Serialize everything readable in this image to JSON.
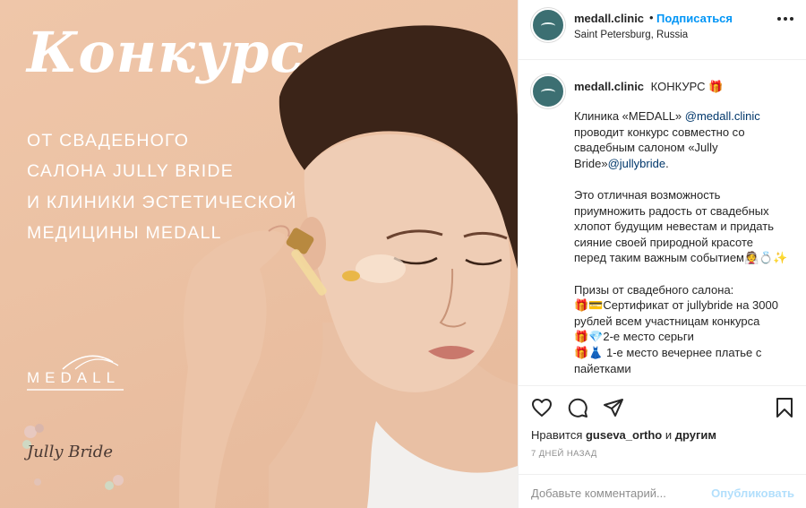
{
  "image": {
    "title": "Конкурс",
    "lines": [
      "ОТ СВАДЕБНОГО",
      "САЛОНА JULLY BRIDE",
      "И КЛИНИКИ ЭСТЕТИЧЕСКОЙ",
      "МЕДИЦИНЫ MEDALL"
    ],
    "logo_medall": "MEDALL",
    "logo_jully": "Jully Bride",
    "colors": {
      "background": "#ecc2a4",
      "text": "#ffffff"
    }
  },
  "header": {
    "username": "medall.clinic",
    "separator": "•",
    "follow_label": "Подписаться",
    "location": "Saint Petersburg, Russia",
    "more_icon": "more-horizontal-icon"
  },
  "caption": {
    "username": "medall.clinic",
    "headline": "КОНКУРС 🎁",
    "p1": {
      "l1a": "Клиника «MEDALL» ",
      "l1m": "@medall.clinic",
      "l2": "проводит конкурс совместно со",
      "l3": "свадебным салоном «Jully",
      "l4a": "Bride»",
      "l4m": "@jullybride",
      "l4b": "."
    },
    "p2": [
      "Это отличная возможность",
      "приумножить радость от свадебных",
      "хлопот будущим невестам и придать",
      "сияние своей природной красоте",
      "перед таким важным событием👰💍✨"
    ],
    "p3": [
      "Призы от свадебного салона:",
      "🎁💳Сертификат от jullybride на 3000",
      "рублей всем участницам конкурса",
      "🎁💎2-е место серьги",
      "🎁👗 1-е место вечернее платье с",
      "пайетками"
    ]
  },
  "actions": {
    "like_icon": "heart-icon",
    "comment_icon": "comment-icon",
    "share_icon": "share-icon",
    "save_icon": "bookmark-icon"
  },
  "likes": {
    "prefix": "Нравится ",
    "user": "guseva_ortho",
    "middle": " и ",
    "others": "другим"
  },
  "date": "7 ДНЕЙ НАЗАД",
  "comment": {
    "placeholder": "Добавьте комментарий...",
    "publish_label": "Опубликовать"
  },
  "colors": {
    "accent": "#0095f6",
    "publish_disabled": "#b2dffc",
    "avatar": "#3c6f72",
    "mention": "#00376b"
  }
}
